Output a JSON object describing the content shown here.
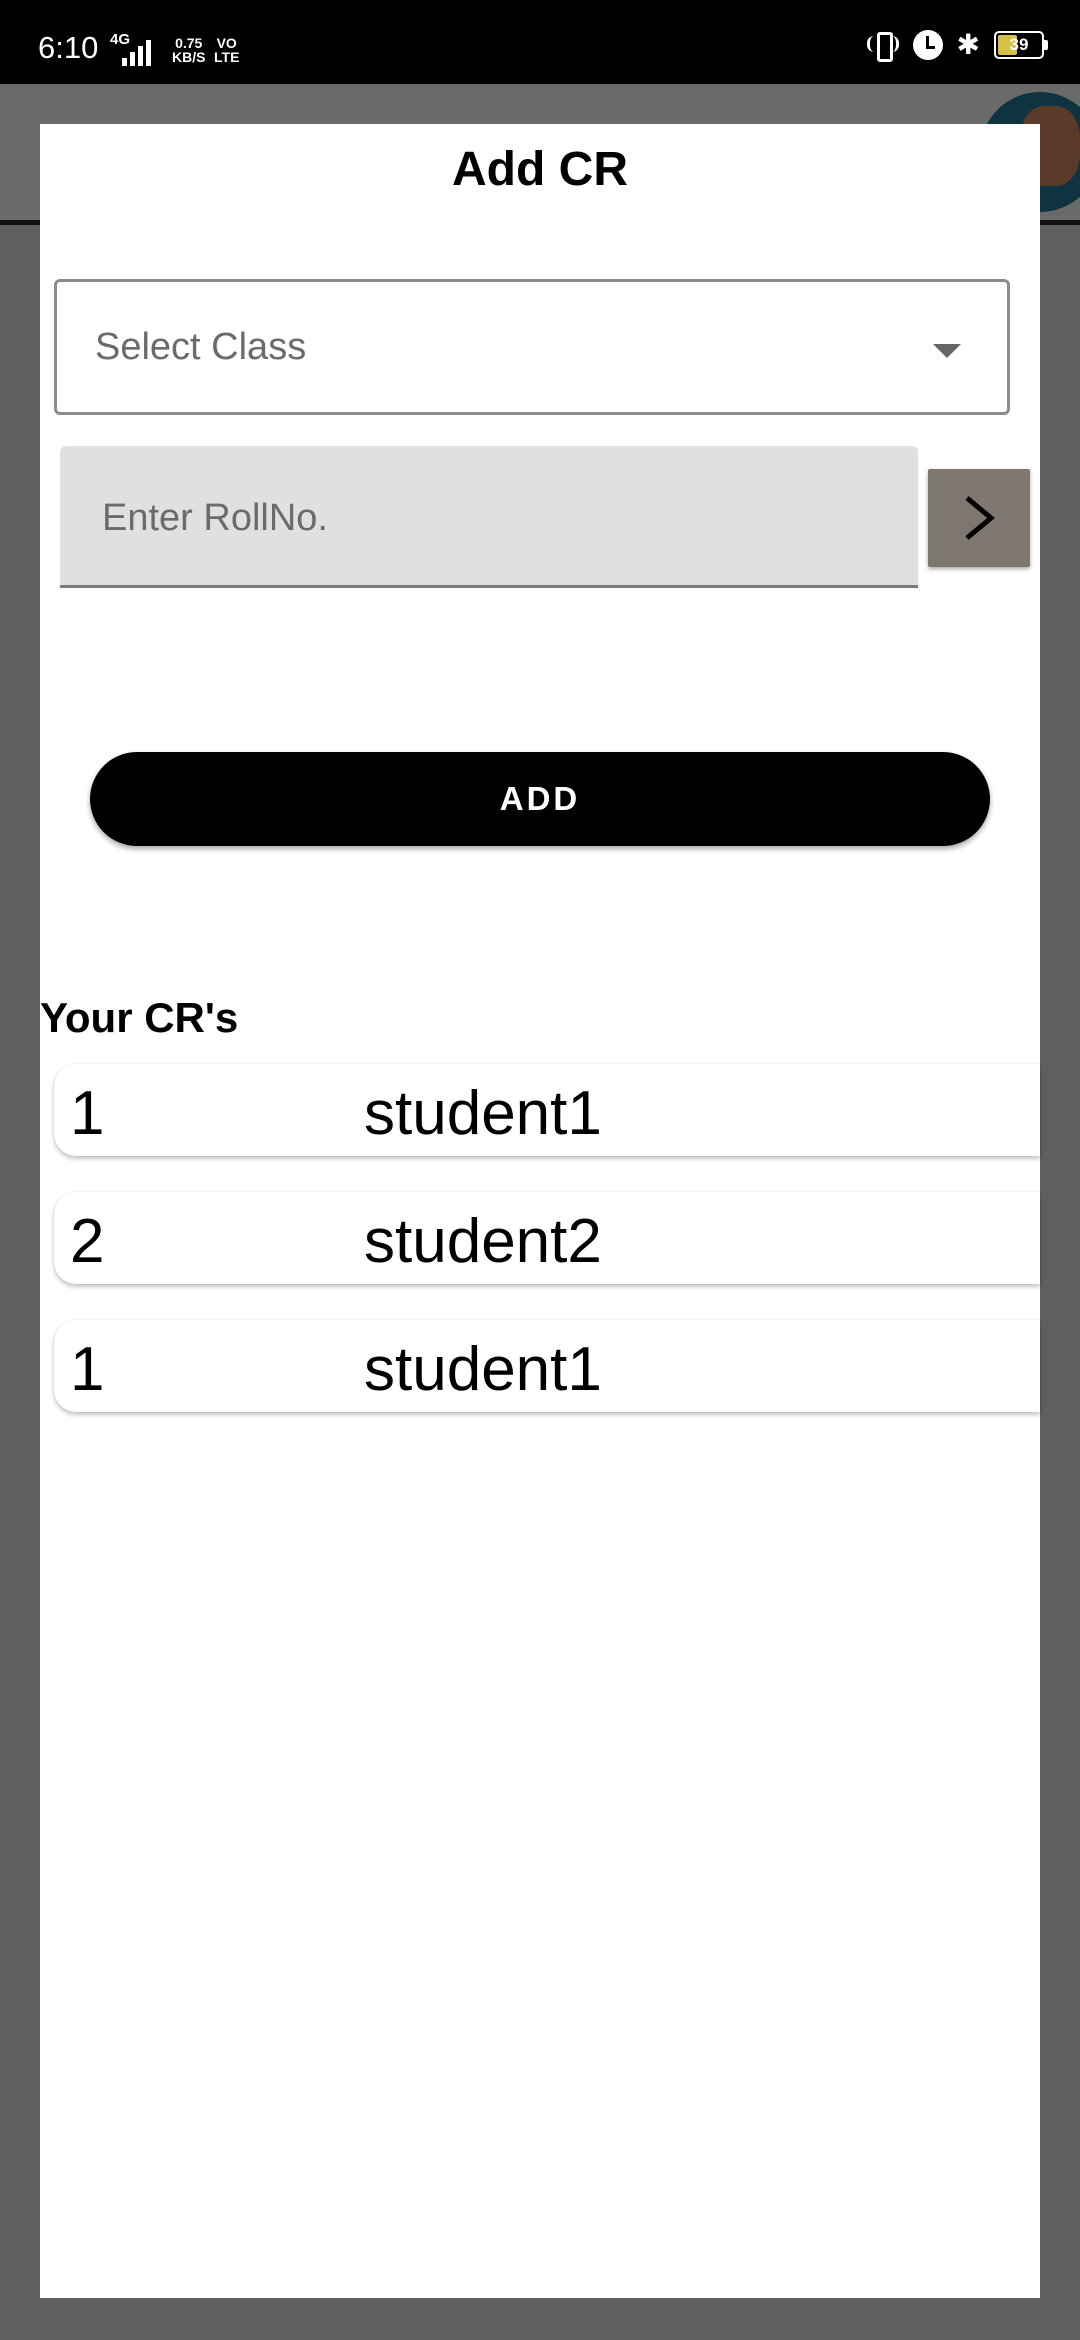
{
  "status_bar": {
    "time": "6:10",
    "network_type": "4G",
    "speed_value": "0.75",
    "speed_unit": "KB/S",
    "volte_top": "VO",
    "volte_bottom": "LTE",
    "battery": "39"
  },
  "dialog": {
    "title": "Add CR",
    "select_class": {
      "placeholder": "Select Class"
    },
    "roll_input": {
      "placeholder": "Enter RollNo.",
      "value": ""
    },
    "go_icon": "chevron-right-icon",
    "add_button_label": "ADD",
    "list_title": "Your CR's",
    "crs": [
      {
        "roll": "1",
        "name": "student1"
      },
      {
        "roll": "2",
        "name": "student2"
      },
      {
        "roll": "1",
        "name": "student1"
      }
    ]
  },
  "colors": {
    "scrim": "#5f5f5f",
    "dialog_bg": "#ffffff",
    "input_fill": "#e0e0e0",
    "go_button": "#7e7770",
    "add_button": "#000000"
  }
}
